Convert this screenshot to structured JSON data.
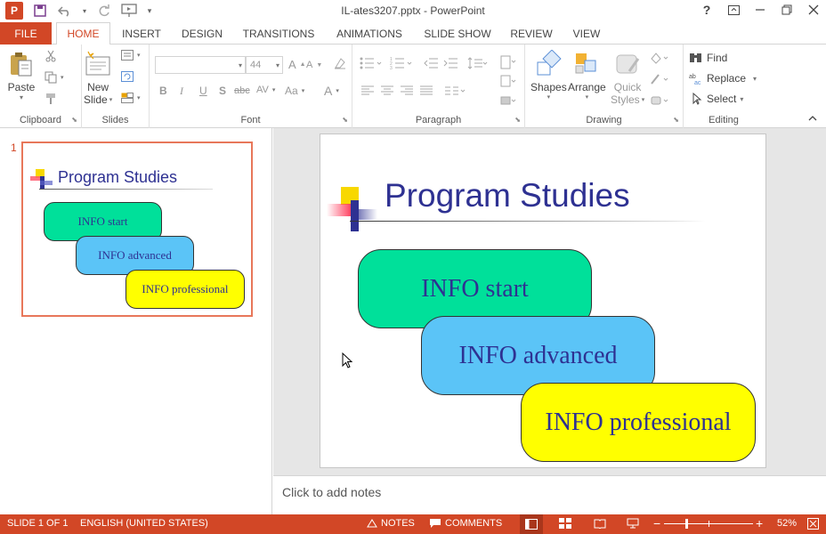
{
  "titlebar": {
    "title": "IL-ates3207.pptx - PowerPoint",
    "app_icon": "P",
    "qat_icons": [
      "save-icon",
      "undo-icon",
      "redo-icon",
      "present-icon",
      "customize-icon"
    ],
    "window_controls": [
      "help-icon",
      "ribbon-display-icon",
      "minimize-icon",
      "restore-icon",
      "close-icon"
    ]
  },
  "tabs": {
    "file": "FILE",
    "items": [
      "HOME",
      "INSERT",
      "DESIGN",
      "TRANSITIONS",
      "ANIMATIONS",
      "SLIDE SHOW",
      "REVIEW",
      "VIEW"
    ],
    "active": "HOME"
  },
  "ribbon": {
    "clipboard": {
      "label": "Clipboard",
      "paste": "Paste"
    },
    "slides": {
      "label": "Slides",
      "new_slide_line1": "New",
      "new_slide_line2": "Slide"
    },
    "font": {
      "label": "Font",
      "font_name": "",
      "font_size": "44",
      "bold": "B",
      "italic": "I",
      "underline": "U",
      "shadow": "S",
      "strike": "abc",
      "spacing": "AV",
      "case": "Aa",
      "color": "A"
    },
    "paragraph": {
      "label": "Paragraph"
    },
    "drawing": {
      "label": "Drawing",
      "shapes": "Shapes",
      "arrange": "Arrange",
      "quick_styles_line1": "Quick",
      "quick_styles_line2": "Styles"
    },
    "editing": {
      "label": "Editing",
      "find": "Find",
      "replace": "Replace",
      "select": "Select"
    }
  },
  "thumbnails": [
    {
      "number": "1"
    }
  ],
  "slide": {
    "title": "Program Studies",
    "shapes": [
      {
        "text": "INFO start",
        "color": "#00e09a"
      },
      {
        "text": "INFO advanced",
        "color": "#5bc4f7"
      },
      {
        "text": "INFO professional",
        "color": "#ffff00"
      }
    ]
  },
  "notes": {
    "placeholder": "Click to add notes"
  },
  "statusbar": {
    "slide_info": "SLIDE 1 OF 1",
    "language": "ENGLISH (UNITED STATES)",
    "notes": "NOTES",
    "comments": "COMMENTS",
    "zoom": "52%",
    "zoom_minus": "−",
    "zoom_plus": "+"
  },
  "colors": {
    "accent": "#d24726",
    "title_text": "#2e3192"
  }
}
